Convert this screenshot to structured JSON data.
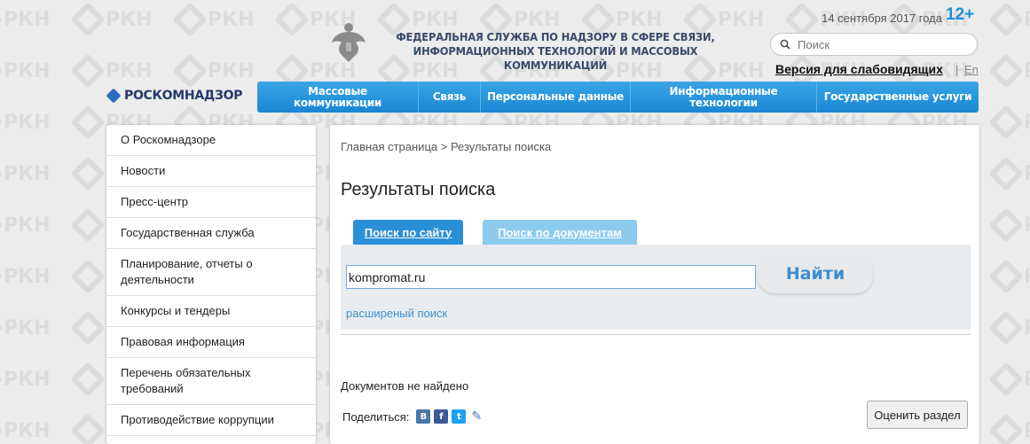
{
  "watermark": {
    "text": "РКН"
  },
  "header": {
    "agency_line1": "ФЕДЕРАЛЬНАЯ СЛУЖБА ПО НАДЗОРУ В СФЕРЕ СВЯЗИ,",
    "agency_line2": "ИНФОРМАЦИОННЫХ ТЕХНОЛОГИЙ И МАССОВЫХ КОММУНИКАЦИЙ",
    "date": "14 сентября 2017 года",
    "age_rating": "12+",
    "search_placeholder": "Поиск",
    "impaired_link": "Версия для слабовидящих",
    "separator": "|",
    "lang_link": "En",
    "logo_text": "РОСКОМНАДЗОР"
  },
  "topnav": [
    {
      "label": "Массовые коммуникации"
    },
    {
      "label": "Связь"
    },
    {
      "label": "Персональные данные"
    },
    {
      "label": "Информационные технологии"
    },
    {
      "label": "Государственные услуги"
    }
  ],
  "sidebar": {
    "items": [
      {
        "label": "О Роскомнадзоре"
      },
      {
        "label": "Новости"
      },
      {
        "label": "Пресс-центр"
      },
      {
        "label": "Государственная служба"
      },
      {
        "label": "Планирование, отчеты о деятельности"
      },
      {
        "label": "Конкурсы и тендеры"
      },
      {
        "label": "Правовая информация"
      },
      {
        "label": "Перечень обязательных требований"
      },
      {
        "label": "Противодействие коррупции"
      }
    ]
  },
  "main": {
    "breadcrumb": "Главная страница > Результаты поиска",
    "title": "Результаты поиска",
    "tab_site": "Поиск по сайту",
    "tab_docs": "Поиск по документам",
    "query_value": "kompromat.ru",
    "find_button": "Найти",
    "advanced_link": "расширеный поиск",
    "not_found": "Документов не найдено",
    "share_label": "Поделиться:",
    "rate_button": "Оценить раздел"
  },
  "colors": {
    "accent": "#1a86d3",
    "background": "#ececec",
    "agency_text": "#384a6a"
  }
}
